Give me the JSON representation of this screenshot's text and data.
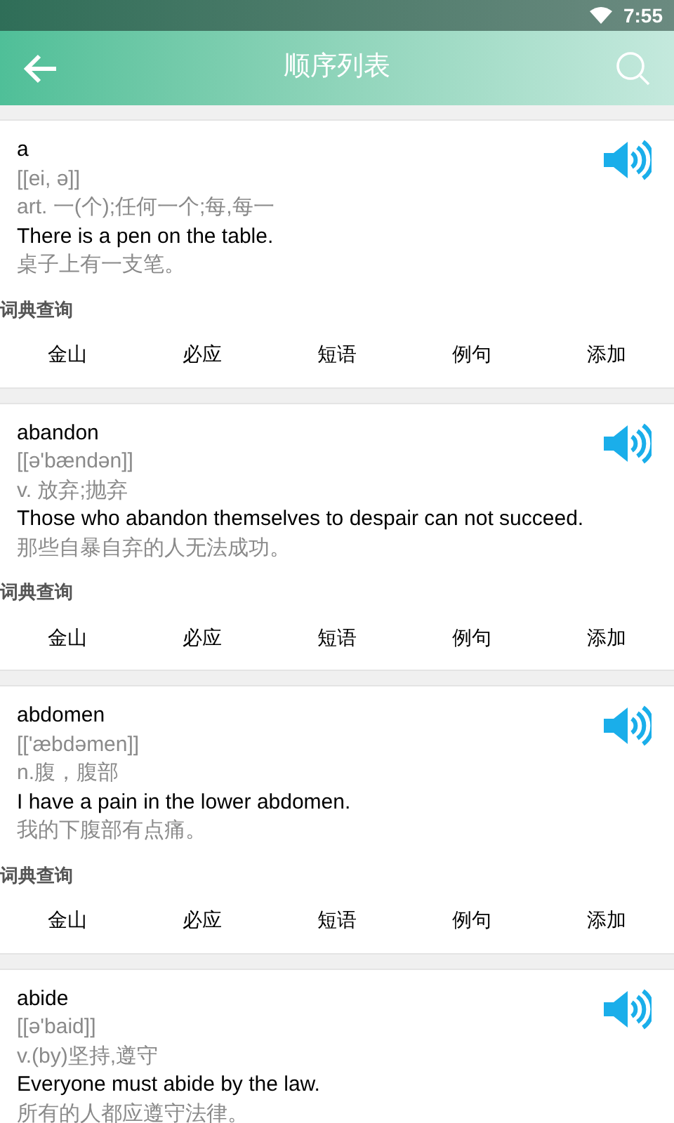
{
  "status_bar": {
    "time": "7:55"
  },
  "header": {
    "title": "顺序列表"
  },
  "entries": [
    {
      "word": "a",
      "phonetic": "[[ei, ə]]",
      "definition": "art. 一(个);任何一个;每,每一",
      "example": "There is a pen on the table.",
      "translation": "桌子上有一支笔。",
      "lookup": {
        "label": "词典查询",
        "actions": [
          "金山",
          "必应",
          "短语",
          "例句",
          "添加"
        ]
      }
    },
    {
      "word": "abandon",
      "phonetic": "[[ə'bændən]]",
      "definition": "v. 放弃;抛弃",
      "example": "Those who abandon themselves to despair can not succeed.",
      "translation": "那些自暴自弃的人无法成功。",
      "lookup": {
        "label": "词典查询",
        "actions": [
          "金山",
          "必应",
          "短语",
          "例句",
          "添加"
        ]
      }
    },
    {
      "word": "abdomen",
      "phonetic": "[['æbdəmen]]",
      "definition": "n.腹，腹部",
      "example": "I have a pain in the lower abdomen.",
      "translation": "我的下腹部有点痛。",
      "lookup": {
        "label": "词典查询",
        "actions": [
          "金山",
          "必应",
          "短语",
          "例句",
          "添加"
        ]
      }
    },
    {
      "word": "abide",
      "phonetic": "[[ə'baid]]",
      "definition": "v.(by)坚持,遵守",
      "example": "Everyone must abide by the law.",
      "translation": "所有的人都应遵守法律。"
    }
  ]
}
